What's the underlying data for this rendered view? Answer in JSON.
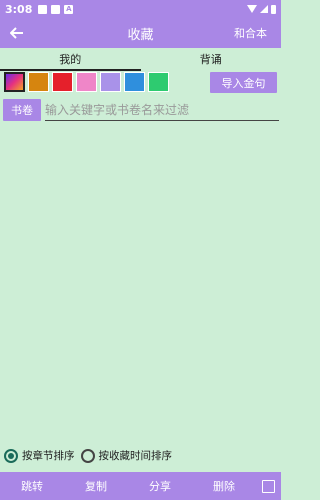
{
  "status_bar": {
    "time": "3:08",
    "notification_badge": "A"
  },
  "app_bar": {
    "back_icon": "arrow-left",
    "title": "收藏",
    "action_label": "和合本"
  },
  "tabs": [
    {
      "label": "我的",
      "active": true
    },
    {
      "label": "背诵",
      "active": false
    }
  ],
  "color_filters": [
    "#gradient",
    "#d6850f",
    "#e5202b",
    "#ef86c8",
    "#a992e9",
    "#2f8fdd",
    "#2ecb70"
  ],
  "import_button": "导入金句",
  "filter": {
    "volume_button": "书卷",
    "placeholder": "输入关键字或书卷名来过滤",
    "value": ""
  },
  "sort": {
    "by_chapter": "按章节排序",
    "by_time": "按收藏时间排序",
    "selected": "by_chapter"
  },
  "bottom_bar": {
    "jump": "跳转",
    "copy": "复制",
    "share": "分享",
    "delete": "删除"
  },
  "colors": {
    "primary": "#a987e6",
    "background": "#cdeed6"
  }
}
